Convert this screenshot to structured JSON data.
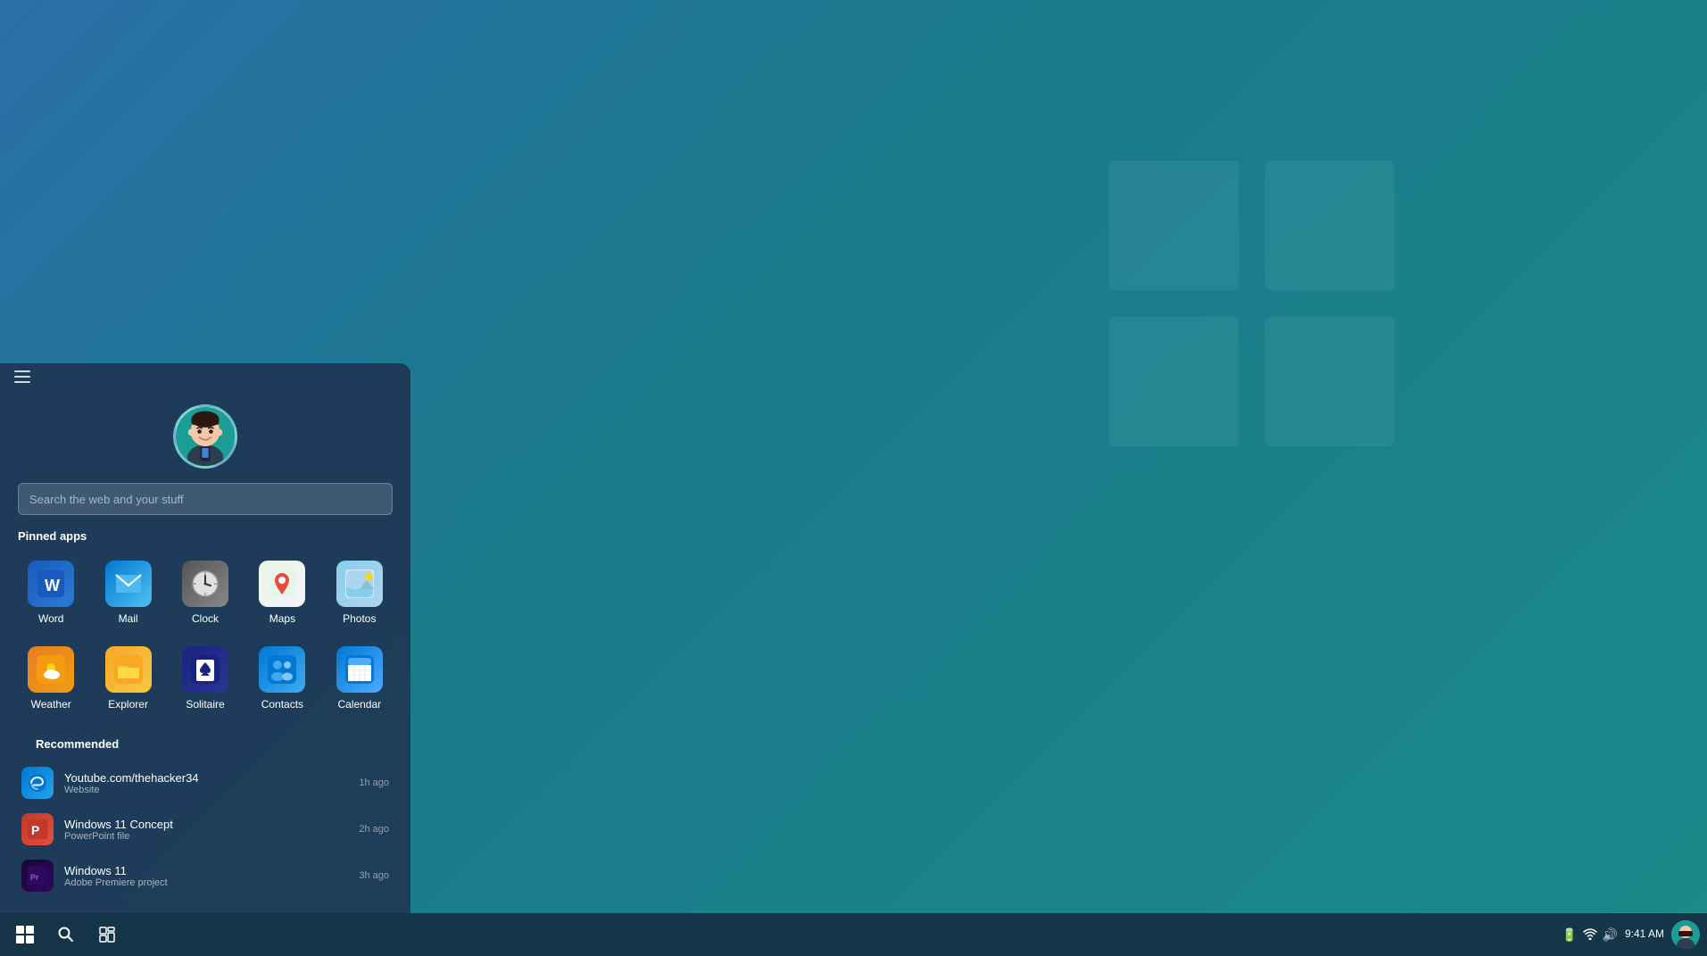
{
  "desktop": {
    "background": "linear-gradient(135deg, #2a6fa8 0%, #1a7a8a 40%, #1a8a8a 100%)"
  },
  "user": {
    "avatar_emoji": "🧑"
  },
  "search": {
    "placeholder": "Search the web and your stuff"
  },
  "pinned_section": {
    "label": "Pinned apps",
    "apps": [
      {
        "id": "word",
        "label": "Word",
        "icon_class": "icon-word",
        "emoji": "W"
      },
      {
        "id": "mail",
        "label": "Mail",
        "icon_class": "icon-mail",
        "emoji": "✉"
      },
      {
        "id": "clock",
        "label": "Clock",
        "icon_class": "icon-clock",
        "emoji": "🕐"
      },
      {
        "id": "maps",
        "label": "Maps",
        "icon_class": "icon-maps",
        "emoji": "📍"
      },
      {
        "id": "photos",
        "label": "Photos",
        "icon_class": "icon-photos",
        "emoji": "🖼"
      },
      {
        "id": "weather",
        "label": "Weather",
        "icon_class": "icon-weather",
        "emoji": "🌤"
      },
      {
        "id": "explorer",
        "label": "Explorer",
        "icon_class": "icon-explorer",
        "emoji": "📁"
      },
      {
        "id": "solitaire",
        "label": "Solitaire",
        "icon_class": "icon-solitaire",
        "emoji": "♠"
      },
      {
        "id": "contacts",
        "label": "Contacts",
        "icon_class": "icon-contacts",
        "emoji": "👥"
      },
      {
        "id": "calendar",
        "label": "Calendar",
        "icon_class": "icon-calendar",
        "emoji": "📅"
      }
    ]
  },
  "recommended_section": {
    "label": "Recommended",
    "items": [
      {
        "id": "youtube",
        "title": "Youtube.com/thehacker34",
        "subtitle": "Website",
        "time": "1h ago",
        "icon_class": "rec-icon-edge",
        "emoji": "🌐"
      },
      {
        "id": "win11concept",
        "title": "Windows 11 Concept",
        "subtitle": "PowerPoint file",
        "time": "2h ago",
        "icon_class": "rec-icon-ppt",
        "emoji": "P"
      },
      {
        "id": "win11",
        "title": "Windows 11",
        "subtitle": "Adobe Premiere project",
        "time": "3h ago",
        "icon_class": "rec-icon-premiere",
        "emoji": "Pr"
      }
    ]
  },
  "taskbar": {
    "time": "9:41 AM",
    "start_label": "⊞",
    "search_label": "🔍"
  }
}
